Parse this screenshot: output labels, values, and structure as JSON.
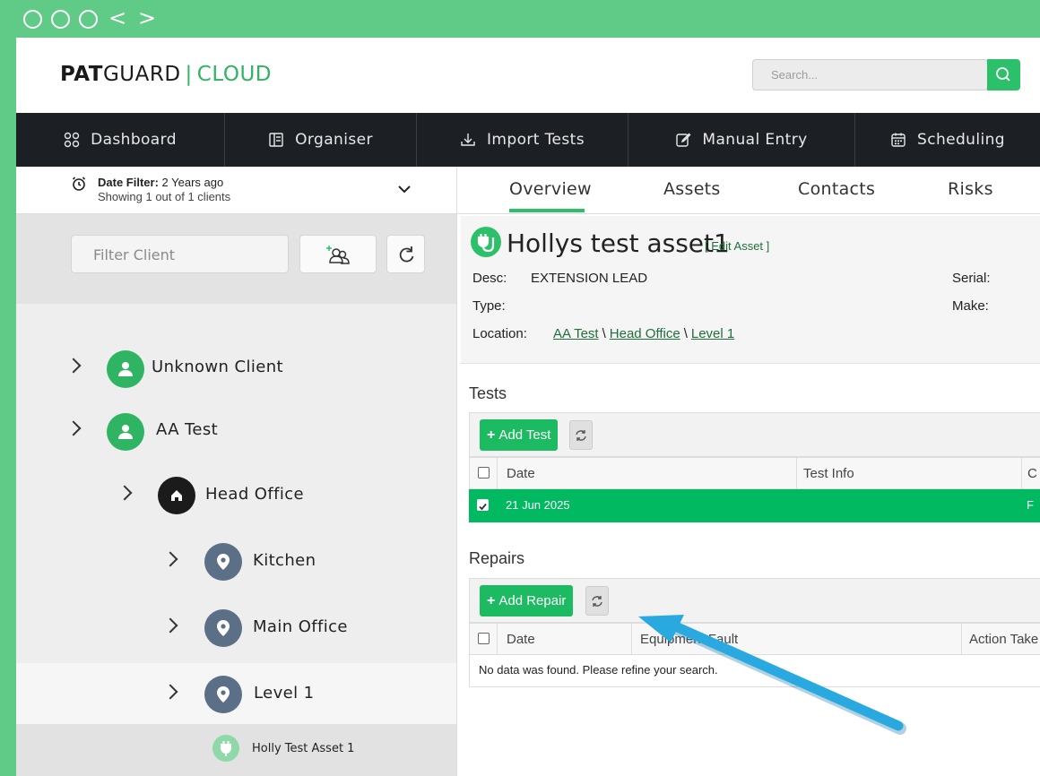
{
  "chrome": {
    "back": "<",
    "forward": ">"
  },
  "header": {
    "logo_pat": "PAT",
    "logo_guard": "GUARD",
    "logo_sep": "|",
    "logo_cloud": "CLOUD",
    "search_placeholder": "Search..."
  },
  "nav": {
    "items": [
      {
        "label": "Dashboard",
        "icon": "grid-icon"
      },
      {
        "label": "Organiser",
        "icon": "organiser-icon"
      },
      {
        "label": "Import Tests",
        "icon": "download-icon"
      },
      {
        "label": "Manual Entry",
        "icon": "edit-icon"
      },
      {
        "label": "Scheduling",
        "icon": "calendar-icon"
      }
    ]
  },
  "left": {
    "date_filter_label": "Date Filter:",
    "date_filter_value": "2 Years ago",
    "showing": "Showing 1 out of 1 clients",
    "filter_placeholder": "Filter Client",
    "tree": [
      {
        "label": "Unknown Client",
        "type": "client"
      },
      {
        "label": "AA Test",
        "type": "client"
      },
      {
        "label": "Head Office",
        "type": "site"
      },
      {
        "label": "Kitchen",
        "type": "location"
      },
      {
        "label": "Main Office",
        "type": "location"
      },
      {
        "label": "Level 1",
        "type": "location"
      },
      {
        "label": "Holly Test Asset 1",
        "type": "asset"
      }
    ]
  },
  "right": {
    "tabs": [
      "Overview",
      "Assets",
      "Contacts",
      "Risks"
    ],
    "asset": {
      "title": "Hollys test asset1",
      "edit_link": "[ Edit Asset ]",
      "desc_label": "Desc:",
      "desc_value": "EXTENSION LEAD",
      "type_label": "Type:",
      "type_value": "",
      "location_label": "Location:",
      "location_path": [
        "AA Test",
        "Head Office",
        "Level 1"
      ],
      "path_sep": "\\",
      "serial_label": "Serial:",
      "make_label": "Make:"
    },
    "tests": {
      "title": "Tests",
      "add_button": "Add Test",
      "columns": [
        "Date",
        "Test Info",
        "C"
      ],
      "rows": [
        {
          "date": "21 Jun 2025",
          "test_info": "",
          "c": "F",
          "checked": true
        }
      ]
    },
    "repairs": {
      "title": "Repairs",
      "add_button": "Add Repair",
      "columns": [
        "Date",
        "Equipment Fault",
        "Action Take"
      ],
      "empty_message": "No data was found. Please refine your search."
    }
  },
  "colors": {
    "accent": "#2cc06a",
    "frame": "#5fcb86",
    "navbar": "#1c1f24",
    "arrow": "#2aa9e0",
    "node_grey": "#5b6f87"
  }
}
